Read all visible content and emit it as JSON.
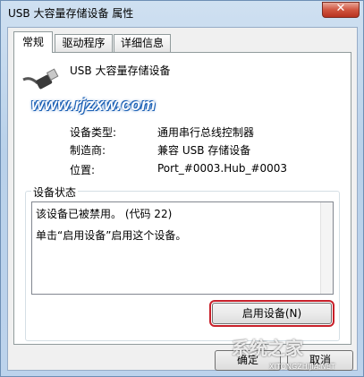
{
  "window": {
    "title": "USB 大容量存储设备 属性",
    "close_symbol": "✕"
  },
  "tabs": [
    {
      "label": "常规",
      "active": true
    },
    {
      "label": "驱动程序",
      "active": false
    },
    {
      "label": "详细信息",
      "active": false
    }
  ],
  "device": {
    "name": "USB 大容量存储设备",
    "icon": "usb-plug-icon",
    "rows": [
      {
        "label": "设备类型:",
        "value": "通用串行总线控制器"
      },
      {
        "label": "制造商:",
        "value": "兼容 USB 存储设备"
      },
      {
        "label": "位置:",
        "value": "Port_#0003.Hub_#0003"
      }
    ]
  },
  "status": {
    "group_title": "设备状态",
    "lines": [
      "该设备已被禁用。 (代码 22)",
      "单击“启用设备”启用这个设备。"
    ],
    "enable_button": "启用设备(N)"
  },
  "buttons": {
    "ok": "确定",
    "cancel": "取消"
  },
  "watermark": {
    "site": "www.rjzxw.com",
    "logo": "系统之家",
    "url": "XITONGZHIJIA.NET"
  }
}
